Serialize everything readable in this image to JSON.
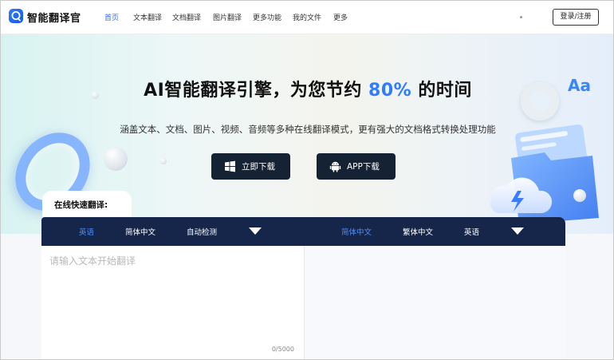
{
  "brand": {
    "name": "智能翻译官",
    "accent": "#2f7cff",
    "icon": "chat-bubble-icon"
  },
  "nav": {
    "items": [
      "首页",
      "文本翻译",
      "文档翻译",
      "图片翻译",
      "更多功能",
      "我的文件",
      "更多"
    ],
    "active_index": 0,
    "login_label": "登录/注册"
  },
  "hero": {
    "title_prefix": "AI智能翻译引擎，为您节约 ",
    "title_highlight": "80%",
    "title_suffix": " 的时间",
    "subtitle": "涵盖文本、文档、图片、视频、音频等多种在线翻译模式，更有强大的文档格式转换处理功能",
    "buttons": [
      {
        "label": "立即下载",
        "icon": "windows-icon"
      },
      {
        "label": "APP下载",
        "icon": "android-icon"
      }
    ],
    "deco_text": "Aa"
  },
  "translator": {
    "section_label": "在线快速翻译:",
    "source_langs": [
      "英语",
      "简体中文",
      "自动检测"
    ],
    "source_selected": 0,
    "target_langs": [
      "简体中文",
      "繁体中文",
      "英语"
    ],
    "target_selected": 0,
    "placeholder": "请输入文本开始翻译",
    "counter": "0/5000",
    "bar_color": "#16264a"
  }
}
